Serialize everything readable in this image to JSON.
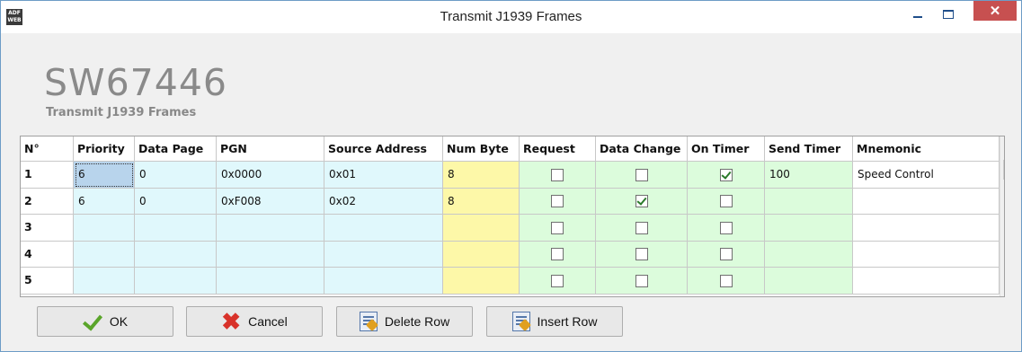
{
  "window": {
    "title": "Transmit J1939 Frames",
    "icon_text": "ADF WEB",
    "close_label": "✕"
  },
  "header": {
    "logo": "SW67446",
    "subtitle": "Transmit J1939 Frames"
  },
  "grid": {
    "columns": [
      "N°",
      "Priority",
      "Data Page",
      "PGN",
      "Source Address",
      "Num Byte",
      "Request",
      "Data Change",
      "On Timer",
      "Send Timer",
      "Mnemonic"
    ],
    "rows": [
      {
        "n": "1",
        "priority": "6",
        "data_page": "0",
        "pgn": "0x0000",
        "source_address": "0x01",
        "num_byte": "8",
        "request": false,
        "data_change": false,
        "on_timer": true,
        "send_timer": "100",
        "mnemonic": "Speed Control"
      },
      {
        "n": "2",
        "priority": "6",
        "data_page": "0",
        "pgn": "0xF008",
        "source_address": "0x02",
        "num_byte": "8",
        "request": false,
        "data_change": true,
        "on_timer": false,
        "send_timer": "",
        "mnemonic": ""
      },
      {
        "n": "3",
        "priority": "",
        "data_page": "",
        "pgn": "",
        "source_address": "",
        "num_byte": "",
        "request": false,
        "data_change": false,
        "on_timer": false,
        "send_timer": "",
        "mnemonic": ""
      },
      {
        "n": "4",
        "priority": "",
        "data_page": "",
        "pgn": "",
        "source_address": "",
        "num_byte": "",
        "request": false,
        "data_change": false,
        "on_timer": false,
        "send_timer": "",
        "mnemonic": ""
      },
      {
        "n": "5",
        "priority": "",
        "data_page": "",
        "pgn": "",
        "source_address": "",
        "num_byte": "",
        "request": false,
        "data_change": false,
        "on_timer": false,
        "send_timer": "",
        "mnemonic": ""
      }
    ]
  },
  "buttons": {
    "ok": "OK",
    "cancel": "Cancel",
    "delete_row": "Delete Row",
    "insert_row": "Insert Row"
  },
  "colors": {
    "cyan": "#e0f8fc",
    "yellow": "#fdf8a8",
    "green": "#dcfcdc",
    "close": "#c75050",
    "title_border": "#6d9cc6"
  }
}
